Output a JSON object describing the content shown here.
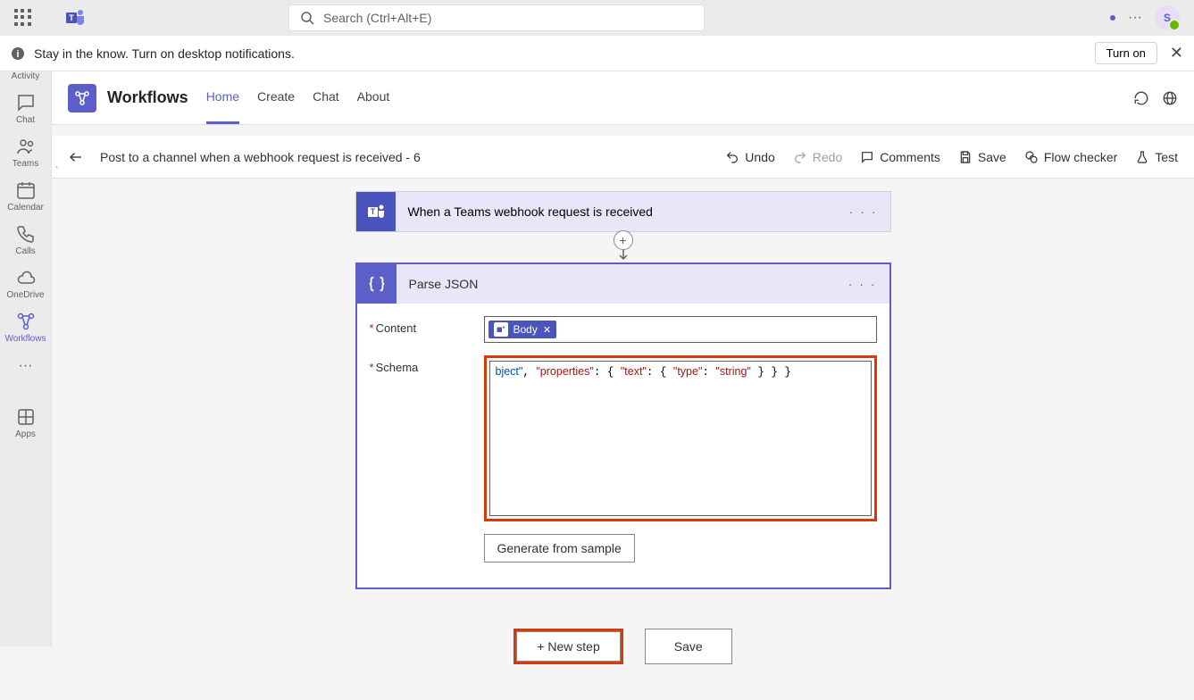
{
  "titlebar": {
    "search_placeholder": "Search (Ctrl+Alt+E)",
    "avatar_initial": "S"
  },
  "notification": {
    "text": "Stay in the know. Turn on desktop notifications.",
    "turn_on": "Turn on"
  },
  "rail": {
    "items": [
      {
        "label": "Activity"
      },
      {
        "label": "Chat"
      },
      {
        "label": "Teams"
      },
      {
        "label": "Calendar"
      },
      {
        "label": "Calls"
      },
      {
        "label": "OneDrive"
      },
      {
        "label": "Workflows"
      }
    ],
    "apps": "Apps"
  },
  "wf": {
    "title": "Workflows",
    "tabs": [
      "Home",
      "Create",
      "Chat",
      "About"
    ]
  },
  "flow": {
    "name": "Post to a channel when a webhook request is received - 6",
    "actions": {
      "undo": "Undo",
      "redo": "Redo",
      "comments": "Comments",
      "save": "Save",
      "checker": "Flow checker",
      "test": "Test"
    }
  },
  "trigger": {
    "title": "When a Teams webhook request is received"
  },
  "parse": {
    "title": "Parse JSON",
    "labels": {
      "content": "Content",
      "schema": "Schema"
    },
    "token": "Body",
    "schema_text": "bject\", \"properties\": { \"text\": { \"type\": \"string\" } } }",
    "generate": "Generate from sample"
  },
  "bottom": {
    "new_step": "+ New step",
    "save": "Save"
  }
}
